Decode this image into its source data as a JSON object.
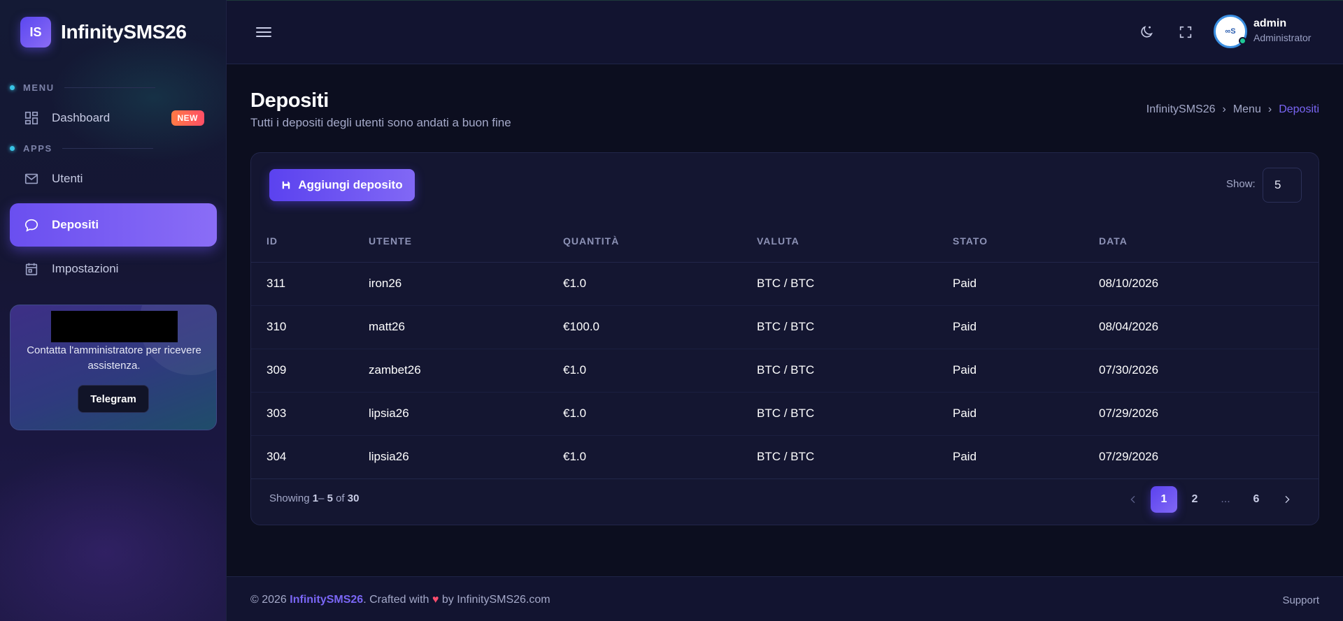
{
  "brand": {
    "logo_text": "IS",
    "name": "InfinitySMS26"
  },
  "sidebar": {
    "sections": [
      {
        "label": "MENU"
      },
      {
        "label": "APPS"
      }
    ],
    "items": [
      {
        "label": "Dashboard",
        "icon": "dashboard-icon",
        "badge": "NEW"
      },
      {
        "label": "Utenti",
        "icon": "mail-icon"
      },
      {
        "label": "Depositi",
        "icon": "chat-bubble-icon",
        "active": true
      },
      {
        "label": "Impostazioni",
        "icon": "calendar-icon"
      }
    ],
    "help_card": {
      "text": "Contatta l'amministratore per ricevere assistenza.",
      "button": "Telegram"
    }
  },
  "header": {
    "user": {
      "name": "admin",
      "role": "Administrator"
    },
    "avatar_text": "∞S"
  },
  "page": {
    "title": "Depositi",
    "subtitle": "Tutti i depositi degli utenti sono andati a buon fine",
    "breadcrumb": [
      "InfinitySMS26",
      "Menu",
      "Depositi"
    ]
  },
  "toolbar": {
    "add_label": "Aggiungi deposito",
    "show_label": "Show:",
    "show_value": "5"
  },
  "table": {
    "columns": [
      "ID",
      "UTENTE",
      "QUANTITÀ",
      "VALUTA",
      "STATO",
      "DATA"
    ],
    "rows": [
      [
        "311",
        "iron26",
        "€1.0",
        "BTC / BTC",
        "Paid",
        "08/10/2026"
      ],
      [
        "310",
        "matt26",
        "€100.0",
        "BTC / BTC",
        "Paid",
        "08/04/2026"
      ],
      [
        "309",
        "zambet26",
        "€1.0",
        "BTC / BTC",
        "Paid",
        "07/30/2026"
      ],
      [
        "303",
        "lipsia26",
        "€1.0",
        "BTC / BTC",
        "Paid",
        "07/29/2026"
      ],
      [
        "304",
        "lipsia26",
        "€1.0",
        "BTC / BTC",
        "Paid",
        "07/29/2026"
      ]
    ]
  },
  "pagination": {
    "showing_prefix": "Showing",
    "range_start": "1",
    "range_sep": "– ",
    "range_end": "5",
    "of_word": "of",
    "total": "30",
    "pages": [
      "1",
      "2",
      "...",
      "6"
    ]
  },
  "footer": {
    "year": "© 2026",
    "brand": "InfinitySMS26",
    "crafted": ". Crafted with",
    "heart": "♥",
    "by": "by InfinitySMS26.com",
    "support": "Support"
  },
  "colors": {
    "accent": "#6a4ff0",
    "badge": "#ff6a50",
    "status_online": "#20c997"
  }
}
